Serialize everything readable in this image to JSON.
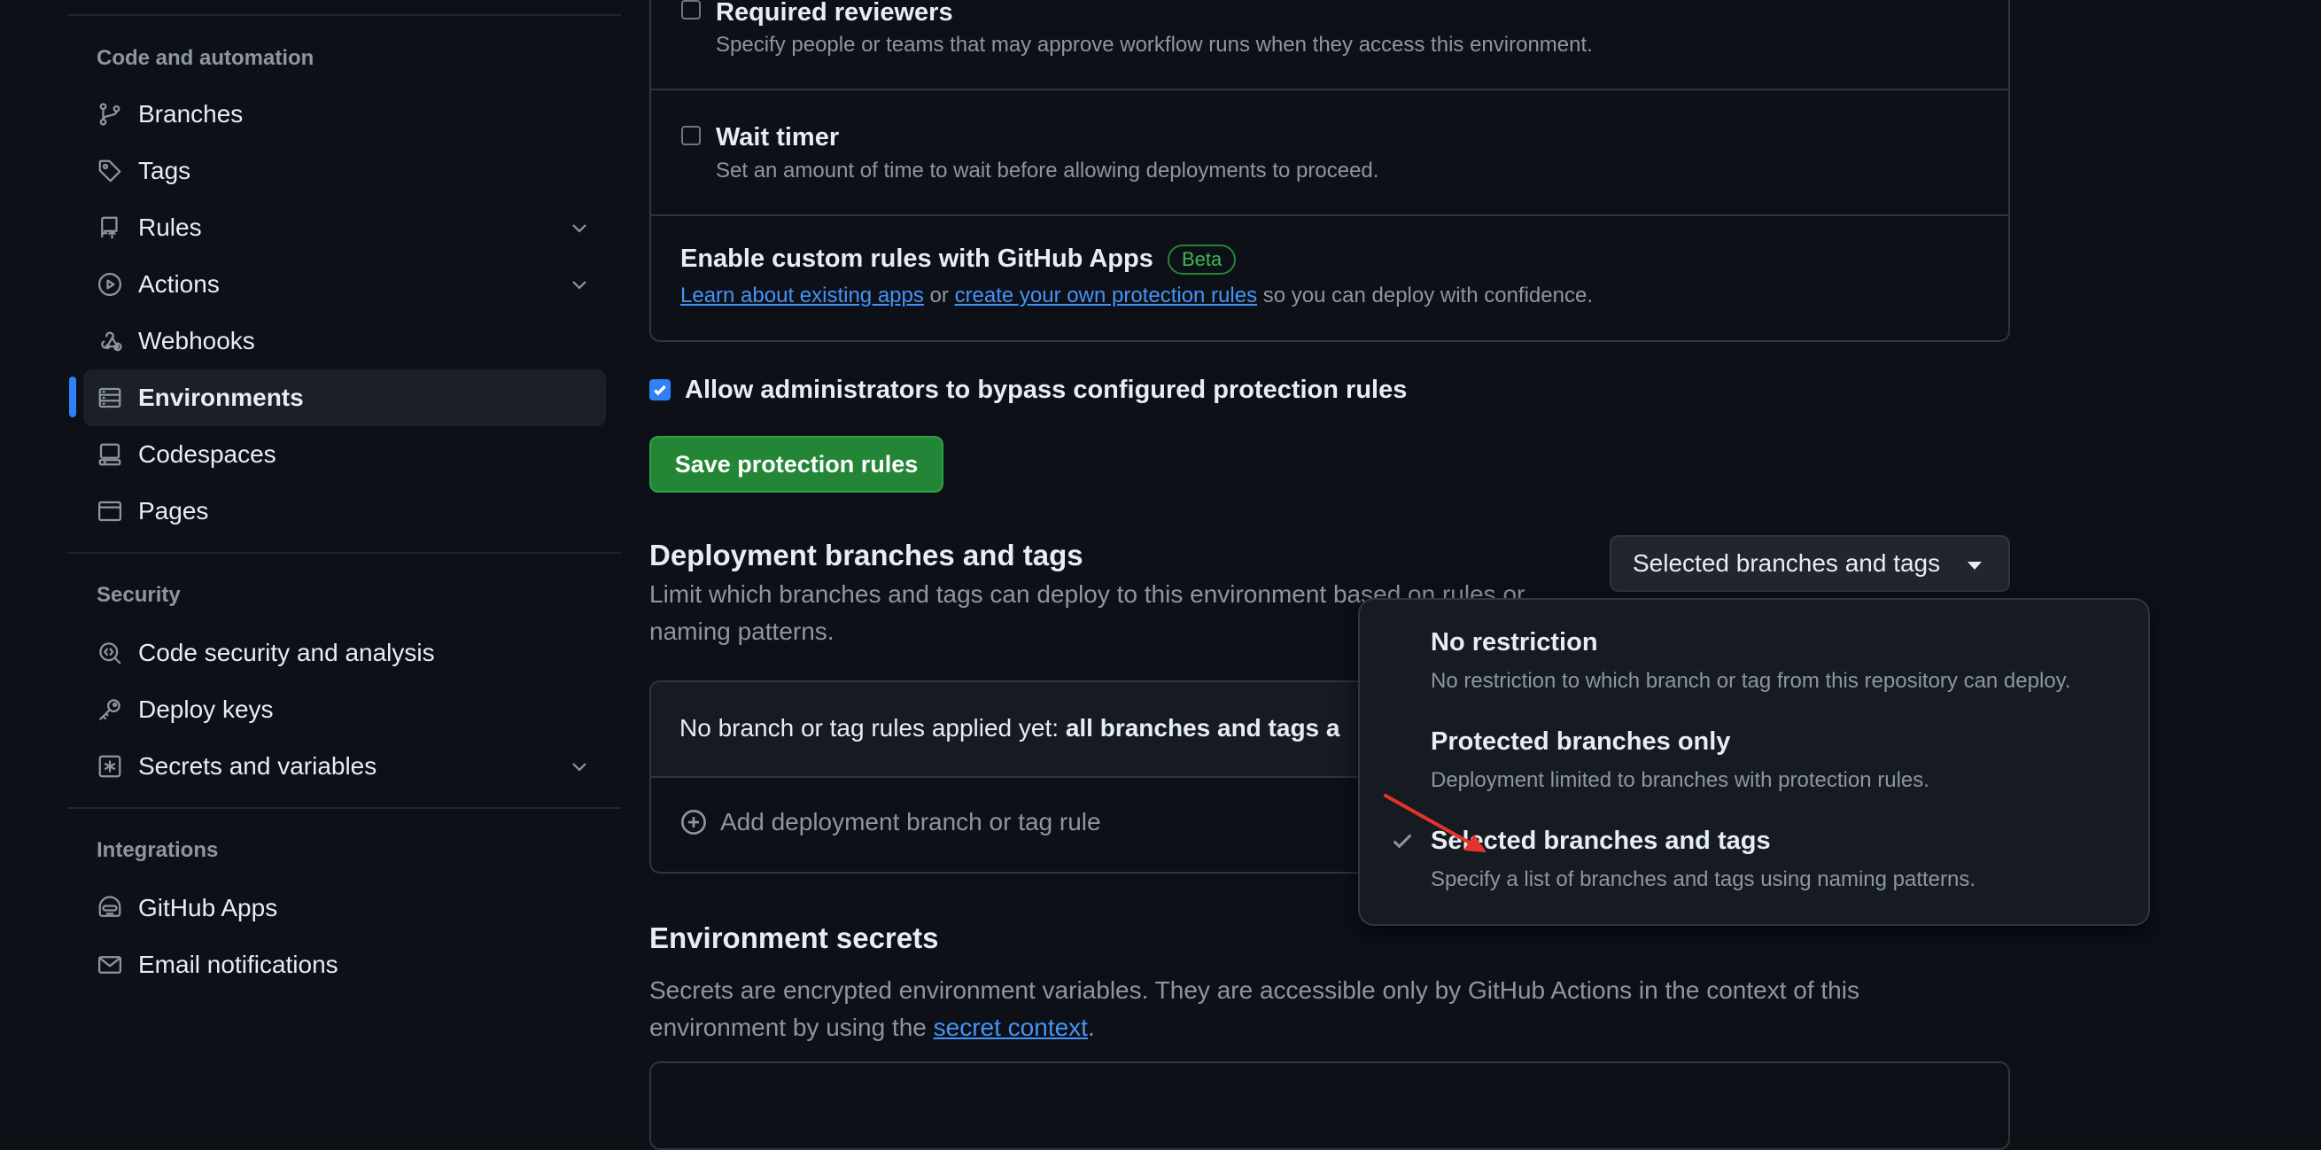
{
  "sidebar": {
    "sections": [
      {
        "heading": "Code and automation"
      },
      {
        "heading": "Security"
      },
      {
        "heading": "Integrations"
      }
    ],
    "items": [
      {
        "label": "Branches",
        "icon": "git-branch-icon"
      },
      {
        "label": "Tags",
        "icon": "tag-icon"
      },
      {
        "label": "Rules",
        "icon": "repo-push-icon",
        "expandable": true
      },
      {
        "label": "Actions",
        "icon": "play-icon",
        "expandable": true
      },
      {
        "label": "Webhooks",
        "icon": "webhook-icon"
      },
      {
        "label": "Environments",
        "icon": "server-icon",
        "active": true
      },
      {
        "label": "Codespaces",
        "icon": "codespaces-icon"
      },
      {
        "label": "Pages",
        "icon": "browser-icon"
      },
      {
        "label": "Code security and analysis",
        "icon": "codescan-icon"
      },
      {
        "label": "Deploy keys",
        "icon": "key-icon"
      },
      {
        "label": "Secrets and variables",
        "icon": "key-asterisk-icon",
        "expandable": true
      },
      {
        "label": "GitHub Apps",
        "icon": "hubot-icon"
      },
      {
        "label": "Email notifications",
        "icon": "mail-icon"
      }
    ]
  },
  "protection_rules": {
    "required_reviewers": {
      "title": "Required reviewers",
      "desc": "Specify people or teams that may approve workflow runs when they access this environment.",
      "checked": false
    },
    "wait_timer": {
      "title": "Wait timer",
      "desc": "Set an amount of time to wait before allowing deployments to proceed.",
      "checked": false
    },
    "custom_rules": {
      "title": "Enable custom rules with GitHub Apps",
      "badge": "Beta",
      "link1": "Learn about existing apps",
      "or": "or",
      "link2": "create your own protection rules",
      "tail": "so you can deploy with confidence."
    },
    "bypass": {
      "label": "Allow administrators to bypass configured protection rules",
      "checked": true
    },
    "save_label": "Save protection rules"
  },
  "deployment": {
    "title": "Deployment branches and tags",
    "desc_line1": "Limit which branches and tags can deploy to this environment based on rules or",
    "desc_line2": "naming patterns.",
    "select_value": "Selected branches and tags",
    "no_rules_prefix": "No branch or tag rules applied yet: ",
    "no_rules_bold": "all branches and tags a",
    "add_rule": "Add deployment branch or tag rule"
  },
  "menu": {
    "options": [
      {
        "title": "No restriction",
        "desc": "No restriction to which branch or tag from this repository can deploy.",
        "selected": false
      },
      {
        "title": "Protected branches only",
        "desc": "Deployment limited to branches with protection rules.",
        "selected": false
      },
      {
        "title": "Selected branches and tags",
        "desc": "Specify a list of branches and tags using naming patterns.",
        "selected": true
      }
    ]
  },
  "secrets": {
    "title": "Environment secrets",
    "desc_line1": "Secrets are encrypted environment variables. They are accessible only by GitHub Actions in the context of this",
    "desc_line2_prefix": "environment by using the ",
    "desc_link": "secret context",
    "desc_line2_suffix": "."
  },
  "colors": {
    "background": "#0d1117",
    "accent": "#2f81f7",
    "save_button": "#238636",
    "annotation_arrow": "#e5322d"
  }
}
